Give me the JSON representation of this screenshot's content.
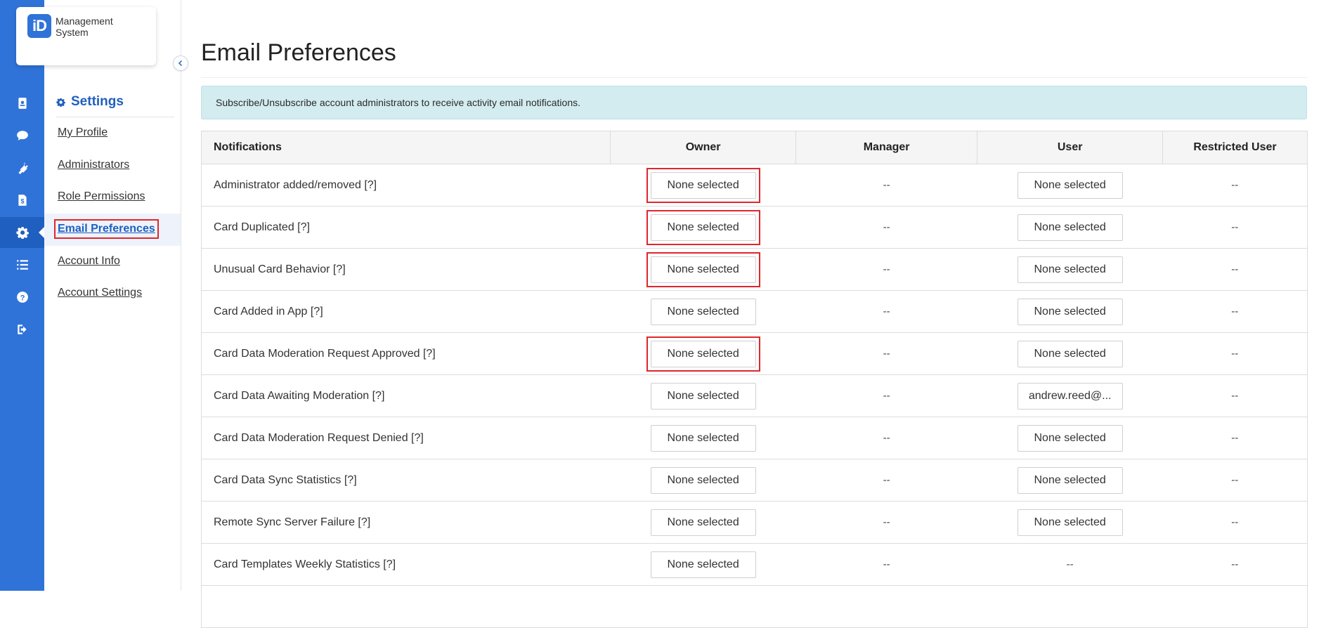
{
  "brand": {
    "logo_mark": "iD",
    "logo_text": "Management System"
  },
  "rail": {
    "items": [
      {
        "icon": "id-card-icon",
        "active": false
      },
      {
        "icon": "chat-icon",
        "active": false
      },
      {
        "icon": "plug-icon",
        "active": false
      },
      {
        "icon": "invoice-icon",
        "active": false
      },
      {
        "icon": "gear-icon",
        "active": true
      },
      {
        "icon": "list-icon",
        "active": false
      },
      {
        "icon": "help-icon",
        "active": false
      },
      {
        "icon": "logout-icon",
        "active": false
      }
    ]
  },
  "settings_nav": {
    "heading": "Settings",
    "items": [
      {
        "label": "My Profile"
      },
      {
        "label": "Administrators"
      },
      {
        "label": "Role Permissions"
      },
      {
        "label": "Email Preferences",
        "active": true
      },
      {
        "label": "Account Info"
      },
      {
        "label": "Account Settings"
      }
    ]
  },
  "page": {
    "title": "Email Preferences",
    "banner": "Subscribe/Unsubscribe account administrators to receive activity email notifications."
  },
  "table": {
    "headers": [
      "Notifications",
      "Owner",
      "Manager",
      "User",
      "Restricted User"
    ],
    "rows": [
      {
        "name": "Administrator added/removed [?]",
        "owner": "None selected",
        "owner_highlight": true,
        "manager": "--",
        "user": "None selected",
        "restricted": "--"
      },
      {
        "name": "Card Duplicated [?]",
        "owner": "None selected",
        "owner_highlight": true,
        "manager": "--",
        "user": "None selected",
        "restricted": "--"
      },
      {
        "name": "Unusual Card Behavior [?]",
        "owner": "None selected",
        "owner_highlight": true,
        "manager": "--",
        "user": "None selected",
        "restricted": "--"
      },
      {
        "name": "Card Added in App [?]",
        "owner": "None selected",
        "owner_highlight": false,
        "manager": "--",
        "user": "None selected",
        "restricted": "--"
      },
      {
        "name": "Card Data Moderation Request Approved [?]",
        "owner": "None selected",
        "owner_highlight": true,
        "manager": "--",
        "user": "None selected",
        "restricted": "--"
      },
      {
        "name": "Card Data Awaiting Moderation [?]",
        "owner": "None selected",
        "owner_highlight": false,
        "manager": "--",
        "user": "andrew.reed@...",
        "restricted": "--"
      },
      {
        "name": "Card Data Moderation Request Denied [?]",
        "owner": "None selected",
        "owner_highlight": false,
        "manager": "--",
        "user": "None selected",
        "restricted": "--"
      },
      {
        "name": "Card Data Sync Statistics [?]",
        "owner": "None selected",
        "owner_highlight": false,
        "manager": "--",
        "user": "None selected",
        "restricted": "--"
      },
      {
        "name": "Remote Sync Server Failure [?]",
        "owner": "None selected",
        "owner_highlight": false,
        "manager": "--",
        "user": "None selected",
        "restricted": "--"
      },
      {
        "name": "Card Templates Weekly Statistics [?]",
        "owner": "None selected",
        "owner_highlight": false,
        "manager": "--",
        "user": "--",
        "restricted": "--"
      },
      {
        "name": "",
        "owner": "",
        "owner_highlight": false,
        "manager": "",
        "user": "",
        "restricted": ""
      }
    ]
  },
  "colors": {
    "rail": "#2f73d8",
    "rail_active": "#1f5fbf",
    "accent": "#1f5fbf",
    "banner_bg": "#d3ecf0",
    "highlight": "#e0262d"
  }
}
